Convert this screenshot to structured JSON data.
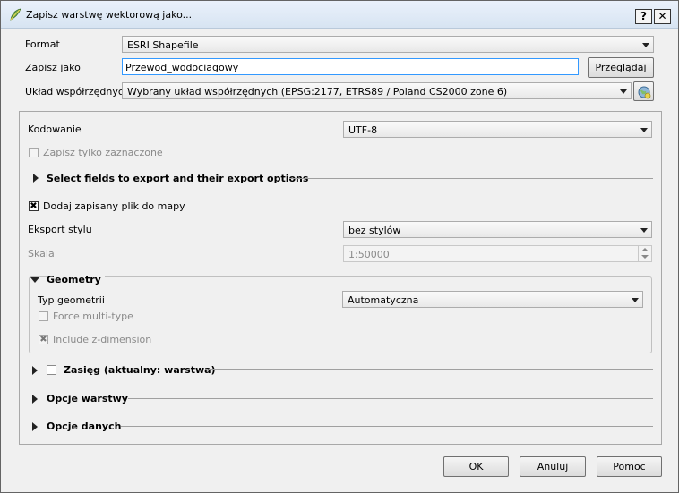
{
  "window": {
    "title": "Zapisz warstwę wektorową jako...",
    "help_label": "?",
    "close_label": "✕"
  },
  "form": {
    "format_label": "Format",
    "format_value": "ESRI Shapefile",
    "save_as_label": "Zapisz jako",
    "save_as_value": "Przewod_wodociagowy",
    "browse_label": "Przeglądaj",
    "crs_label": "Układ współrzędnych",
    "crs_value": "Wybrany układ współrzędnych (EPSG:2177, ETRS89 / Poland CS2000 zone 6)"
  },
  "options": {
    "encoding_label": "Kodowanie",
    "encoding_value": "UTF-8",
    "selected_only_label": "Zapisz tylko zaznaczone",
    "fields_section_label": "Select fields to export and their export options",
    "add_to_map_label": "Dodaj zapisany plik do mapy",
    "style_export_label": "Eksport stylu",
    "style_export_value": "bez stylów",
    "scale_label": "Skala",
    "scale_value": "1:50000"
  },
  "geometry": {
    "section_label": "Geometry",
    "type_label": "Typ geometrii",
    "type_value": "Automatyczna",
    "force_multi_label": "Force multi-type",
    "include_z_label": "Include z-dimension"
  },
  "sections": {
    "extent_label": "Zasięg (aktualny: warstwa)",
    "layer_options_label": "Opcje warstwy",
    "data_options_label": "Opcje danych"
  },
  "buttons": {
    "ok": "OK",
    "cancel": "Anuluj",
    "help": "Pomoc"
  },
  "checkmarks": {
    "checked": "✖"
  },
  "colors": {
    "accent_border": "#3399ff",
    "icon_green": "#6aa84f",
    "icon_yellow": "#e8d44d"
  }
}
